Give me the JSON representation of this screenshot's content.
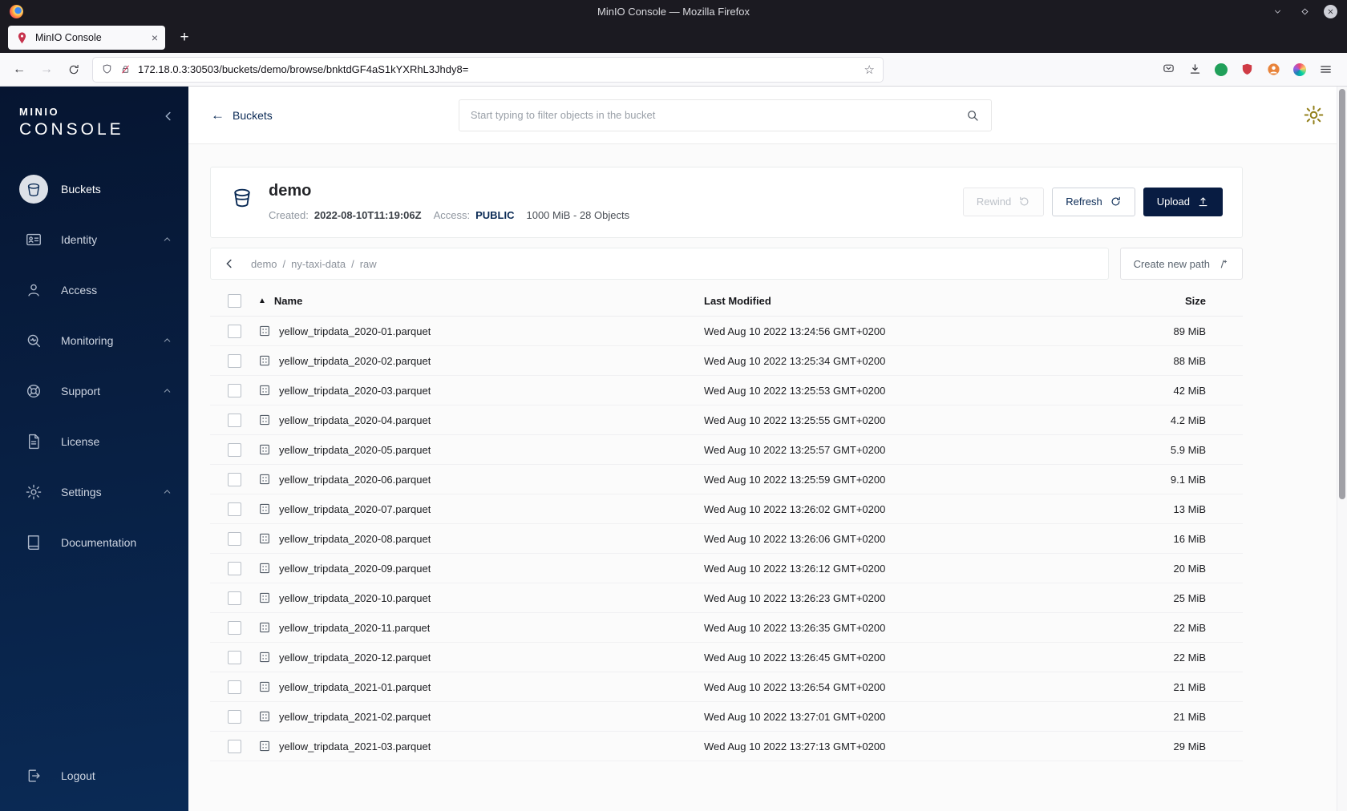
{
  "colors": {
    "accent_navy": "#081c42",
    "brand_red": "#c7334d",
    "gear_gold": "#93801c",
    "disabled_gray": "#bcc1c8"
  },
  "window": {
    "title": "MinIO Console — Mozilla Firefox"
  },
  "browser": {
    "tab_title": "MinIO Console",
    "url": "172.18.0.3:30503/buckets/demo/browse/bnktdGF4aS1kYXRhL3Jhdy8="
  },
  "icons": {
    "sort_asc": "▲",
    "back_arrow": "←",
    "forward_arrow": "→",
    "star": "☆",
    "plus": "+",
    "close_x": "×"
  },
  "sidebar": {
    "brand_line1": "MINIO",
    "brand_line2": "CONSOLE",
    "items": [
      {
        "label": "Buckets",
        "active": true
      },
      {
        "label": "Identity",
        "expandable": true
      },
      {
        "label": "Access"
      },
      {
        "label": "Monitoring",
        "expandable": true
      },
      {
        "label": "Support",
        "expandable": true
      },
      {
        "label": "License"
      },
      {
        "label": "Settings",
        "expandable": true
      },
      {
        "label": "Documentation"
      }
    ],
    "logout_label": "Logout"
  },
  "header": {
    "back_label": "Buckets",
    "search_placeholder": "Start typing to filter objects in the bucket"
  },
  "bucket": {
    "name": "demo",
    "created_label": "Created:",
    "created_value": "2022-08-10T11:19:06Z",
    "access_label": "Access:",
    "access_value": "PUBLIC",
    "size_objects": "1000 MiB - 28 Objects",
    "buttons": {
      "rewind": "Rewind",
      "refresh": "Refresh",
      "upload": "Upload"
    }
  },
  "pathbar": {
    "crumbs": [
      "demo",
      "ny-taxi-data",
      "raw"
    ],
    "separator": "/",
    "create_button": "Create new path"
  },
  "objects": {
    "columns": {
      "name": "Name",
      "last_modified": "Last Modified",
      "size": "Size"
    },
    "rows": [
      {
        "name": "yellow_tripdata_2020-01.parquet",
        "modified": "Wed Aug 10 2022 13:24:56 GMT+0200",
        "size": "89 MiB"
      },
      {
        "name": "yellow_tripdata_2020-02.parquet",
        "modified": "Wed Aug 10 2022 13:25:34 GMT+0200",
        "size": "88 MiB"
      },
      {
        "name": "yellow_tripdata_2020-03.parquet",
        "modified": "Wed Aug 10 2022 13:25:53 GMT+0200",
        "size": "42 MiB"
      },
      {
        "name": "yellow_tripdata_2020-04.parquet",
        "modified": "Wed Aug 10 2022 13:25:55 GMT+0200",
        "size": "4.2 MiB"
      },
      {
        "name": "yellow_tripdata_2020-05.parquet",
        "modified": "Wed Aug 10 2022 13:25:57 GMT+0200",
        "size": "5.9 MiB"
      },
      {
        "name": "yellow_tripdata_2020-06.parquet",
        "modified": "Wed Aug 10 2022 13:25:59 GMT+0200",
        "size": "9.1 MiB"
      },
      {
        "name": "yellow_tripdata_2020-07.parquet",
        "modified": "Wed Aug 10 2022 13:26:02 GMT+0200",
        "size": "13 MiB"
      },
      {
        "name": "yellow_tripdata_2020-08.parquet",
        "modified": "Wed Aug 10 2022 13:26:06 GMT+0200",
        "size": "16 MiB"
      },
      {
        "name": "yellow_tripdata_2020-09.parquet",
        "modified": "Wed Aug 10 2022 13:26:12 GMT+0200",
        "size": "20 MiB"
      },
      {
        "name": "yellow_tripdata_2020-10.parquet",
        "modified": "Wed Aug 10 2022 13:26:23 GMT+0200",
        "size": "25 MiB"
      },
      {
        "name": "yellow_tripdata_2020-11.parquet",
        "modified": "Wed Aug 10 2022 13:26:35 GMT+0200",
        "size": "22 MiB"
      },
      {
        "name": "yellow_tripdata_2020-12.parquet",
        "modified": "Wed Aug 10 2022 13:26:45 GMT+0200",
        "size": "22 MiB"
      },
      {
        "name": "yellow_tripdata_2021-01.parquet",
        "modified": "Wed Aug 10 2022 13:26:54 GMT+0200",
        "size": "21 MiB"
      },
      {
        "name": "yellow_tripdata_2021-02.parquet",
        "modified": "Wed Aug 10 2022 13:27:01 GMT+0200",
        "size": "21 MiB"
      },
      {
        "name": "yellow_tripdata_2021-03.parquet",
        "modified": "Wed Aug 10 2022 13:27:13 GMT+0200",
        "size": "29 MiB"
      }
    ]
  }
}
